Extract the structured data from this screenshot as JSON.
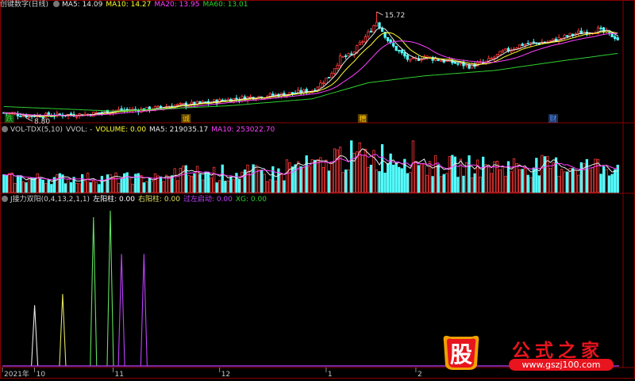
{
  "colors": {
    "bg": "#000000",
    "frame": "#8b0000",
    "text": "#c8c8c8",
    "up": "#ff3a3a",
    "down": "#54ffff",
    "ma5": "#e8e8e8",
    "ma10": "#ffff30",
    "ma20": "#ff40ff",
    "ma60": "#30d030",
    "right": "#e0e060",
    "left": "#ffffff",
    "purple": "#c040ff",
    "green": "#60e060"
  },
  "price_panel": {
    "title": "创键数字(日线)",
    "indicators": [
      {
        "label": "MA5: 14.09",
        "color": "#e8e8e8"
      },
      {
        "label": "MA10: 14.27",
        "color": "#ffff30"
      },
      {
        "label": "MA20: 13.95",
        "color": "#ff40ff"
      },
      {
        "label": "MA60: 13.01",
        "color": "#30d030"
      }
    ],
    "high_label": "15.72",
    "low_label": "8.80",
    "events": [
      {
        "label": "跌",
        "bar": 2,
        "color": "#30d030"
      },
      {
        "label": "诚",
        "bar": 65,
        "color": "#ffc000"
      },
      {
        "label": "糟",
        "bar": 128,
        "color": "#ffc000"
      },
      {
        "label": "财",
        "bar": 196,
        "color": "#5090ff"
      }
    ]
  },
  "volume_panel": {
    "title": "VOL-TDX(5,10)",
    "indicators": [
      {
        "label": "VVOL: -",
        "color": "#c8c8c8"
      },
      {
        "label": "VOLUME: 0.00",
        "color": "#ffff30"
      },
      {
        "label": "MA5: 219035.17",
        "color": "#e8e8e8"
      },
      {
        "label": "MA10: 253022.70",
        "color": "#ff40ff"
      }
    ]
  },
  "signal_panel": {
    "title": "J接力双阳(0,4,13,2,1,1)",
    "indicators": [
      {
        "label": "左阳柱: 0.00",
        "color": "#ffffff"
      },
      {
        "label": "右阳柱: 0.00",
        "color": "#e0e060"
      },
      {
        "label": "过左启动: 0.00",
        "color": "#c040ff"
      },
      {
        "label": "XG: 0.00",
        "color": "#30d030"
      }
    ]
  },
  "x_axis": {
    "labels": [
      {
        "label": "2021年",
        "bar": 0
      },
      {
        "label": "10",
        "bar": 11
      },
      {
        "label": "11",
        "bar": 39
      },
      {
        "label": "12",
        "bar": 77
      },
      {
        "label": "1",
        "bar": 115
      },
      {
        "label": "2",
        "bar": 147
      }
    ]
  },
  "watermark": {
    "seal_char": "股",
    "title": "公式之家",
    "url": "www.gszj100.com"
  },
  "chart_data": {
    "type": "candlestick",
    "bars": 220,
    "price": {
      "min": 8.8,
      "max": 15.72,
      "high_bar": 133,
      "low_bar": 8
    },
    "close_path": [
      [
        0,
        9.15
      ],
      [
        8,
        8.95
      ],
      [
        20,
        9.0
      ],
      [
        30,
        9.05
      ],
      [
        40,
        9.3
      ],
      [
        50,
        9.35
      ],
      [
        60,
        9.6
      ],
      [
        70,
        9.75
      ],
      [
        80,
        10.0
      ],
      [
        90,
        10.2
      ],
      [
        100,
        10.35
      ],
      [
        110,
        10.6
      ],
      [
        116,
        11.5
      ],
      [
        120,
        12.7
      ],
      [
        124,
        12.9
      ],
      [
        130,
        14.3
      ],
      [
        133,
        15.1
      ],
      [
        138,
        13.6
      ],
      [
        145,
        12.5
      ],
      [
        150,
        12.8
      ],
      [
        158,
        12.5
      ],
      [
        166,
        12.2
      ],
      [
        172,
        12.45
      ],
      [
        178,
        13.1
      ],
      [
        185,
        13.6
      ],
      [
        195,
        13.8
      ],
      [
        205,
        14.35
      ],
      [
        212,
        14.55
      ],
      [
        218,
        14.1
      ],
      [
        219,
        13.95
      ]
    ],
    "ma60_path": [
      [
        0,
        9.55
      ],
      [
        40,
        9.25
      ],
      [
        80,
        9.6
      ],
      [
        110,
        10.05
      ],
      [
        130,
        11.1
      ],
      [
        150,
        11.55
      ],
      [
        175,
        11.9
      ],
      [
        200,
        12.55
      ],
      [
        219,
        13.01
      ]
    ],
    "volume": {
      "max": 420000,
      "ma5": 219035.17,
      "ma10": 253022.7
    },
    "signals": [
      {
        "bar": 11,
        "height": 0.38,
        "color": "#e8e8e8"
      },
      {
        "bar": 21,
        "height": 0.45,
        "color": "#e0e060"
      },
      {
        "bar": 32,
        "height": 0.93,
        "color": "#60e060"
      },
      {
        "bar": 38,
        "height": 0.97,
        "color": "#60e060"
      },
      {
        "bar": 42,
        "height": 0.7,
        "color": "#c040ff"
      },
      {
        "bar": 50,
        "height": 0.7,
        "color": "#c040ff"
      }
    ]
  }
}
